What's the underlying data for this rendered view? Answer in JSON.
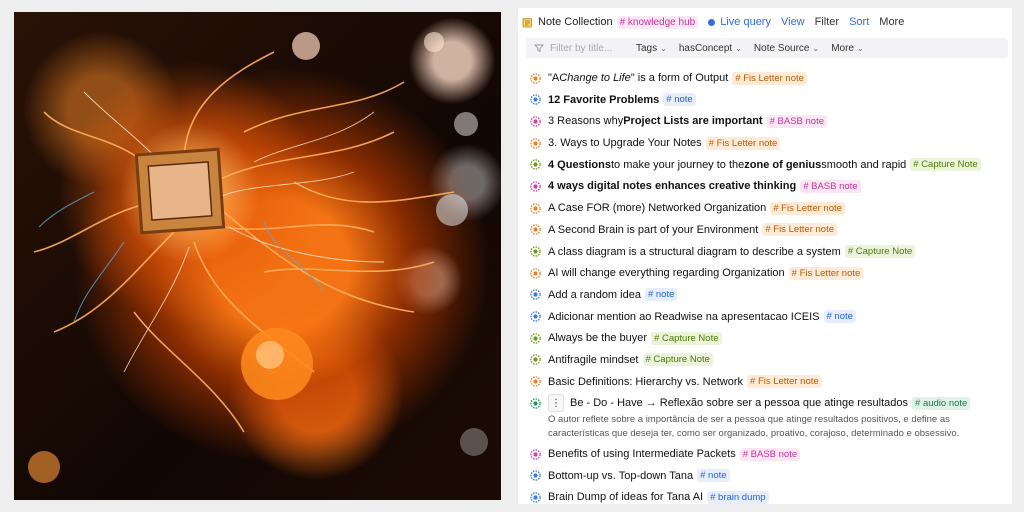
{
  "header": {
    "title": "Note Collection",
    "hub_tag": "# knowledge hub",
    "live_query": "Live query",
    "view": "View",
    "filter": "Filter",
    "sort": "Sort",
    "more": "More"
  },
  "toolbar": {
    "filter_placeholder": "Filter by title...",
    "tags": "Tags",
    "has_concept": "hasConcept",
    "note_source": "Note Source",
    "more": "More"
  },
  "notes": [
    {
      "pre": "\"A ",
      "italic": "Change to Life",
      "post": "\" is a form of Output",
      "tag": "# Fis Letter note",
      "type": "fis"
    },
    {
      "bold": "12 Favorite Problems",
      "tag": "# note",
      "type": "note"
    },
    {
      "pre": "3 Reasons why ",
      "bold": "Project Lists are important",
      "tag": "# BASB note",
      "type": "basb"
    },
    {
      "pre": "3. Ways to Upgrade Your Notes",
      "tag": "# Fis Letter note",
      "type": "fis"
    },
    {
      "bold": "4 Questions",
      "mid": " to make your journey to the ",
      "bold2": "zone of genius",
      "post": " smooth and rapid",
      "tag": "# Capture Note",
      "type": "capture"
    },
    {
      "bold": "4 ways digital notes enhances creative thinking",
      "tag": "# BASB note",
      "type": "basb"
    },
    {
      "pre": "A Case FOR (more) Networked Organization",
      "tag": "# Fis Letter note",
      "type": "fis"
    },
    {
      "pre": "A Second Brain is part of your Environment",
      "tag": "# Fis Letter note",
      "type": "fis"
    },
    {
      "pre": "A class diagram is a structural diagram to describe a system",
      "tag": "# Capture Note",
      "type": "capture"
    },
    {
      "pre": "AI will change everything regarding Organization",
      "tag": "# Fis Letter note",
      "type": "fis"
    },
    {
      "pre": "Add a random idea",
      "tag": "# note",
      "type": "note"
    },
    {
      "pre": "Adicionar mention ao Readwise na apresentacao ICEIS",
      "tag": "# note",
      "type": "note"
    },
    {
      "pre": "Always be the buyer",
      "tag": "# Capture Note",
      "type": "capture"
    },
    {
      "pre": "Antifragile mindset",
      "tag": "# Capture Note",
      "type": "capture"
    },
    {
      "pre": "Basic Definitions: Hierarchy vs. Network",
      "tag": "# Fis Letter note",
      "type": "fis"
    }
  ],
  "audio_note": {
    "menu": "⋮",
    "pre": "Be - Do - Have",
    "arrow": "→",
    "post": "Reflexão sobre ser a pessoa que atinge resultados",
    "tag": "# audio note",
    "description": "O autor reflete sobre a importância de ser a pessoa que atinge resultados positivos, e define as características que deseja ter, como ser organizado, proativo, corajoso, determinado e obsessivo."
  },
  "notes_after": [
    {
      "pre": "Benefits of using Intermediate Packets",
      "tag": "# BASB note",
      "type": "basb"
    },
    {
      "pre": "Bottom-up vs. Top-down Tana",
      "tag": "# note",
      "type": "note"
    },
    {
      "pre": "Brain Dump of ideas for Tana AI",
      "tag": "# brain dump",
      "type": "brain"
    }
  ],
  "colors": {
    "fis": "#e8812b",
    "note": "#3b78e7",
    "basb": "#d43fa6",
    "capture": "#6b9a1f",
    "audio": "#1f9a5a",
    "brain": "#3b78e7"
  }
}
